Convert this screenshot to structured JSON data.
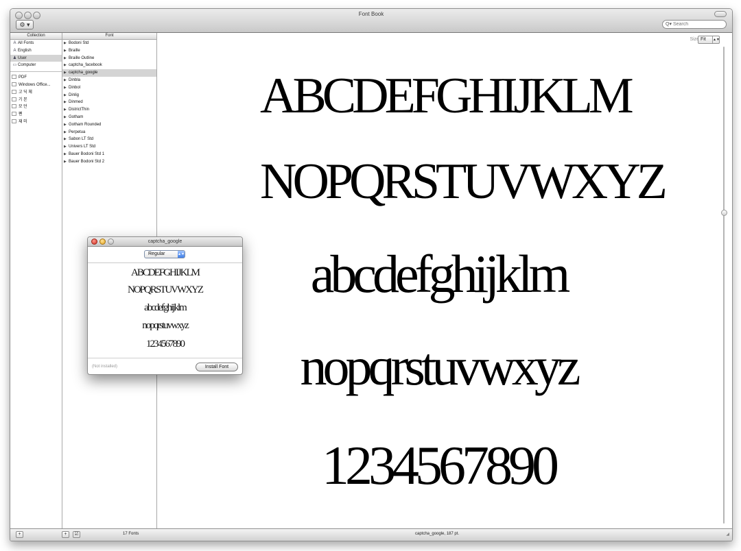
{
  "window": {
    "title": "Font Book"
  },
  "toolbar": {
    "action_label": "⚙ ▾",
    "search_placeholder": "Search"
  },
  "collections": {
    "header": "Collection",
    "items": [
      {
        "icon": "A",
        "label": "All Fonts"
      },
      {
        "icon": "A",
        "label": "English"
      },
      {
        "icon": "♟",
        "label": "User"
      },
      {
        "icon": "▭",
        "label": "Computer"
      }
    ],
    "groups": [
      "PDF",
      "Windows Office...",
      "고 딕 체",
      "기 본",
      "모 던",
      "펜",
      "재 미"
    ]
  },
  "fonts": {
    "header": "Font",
    "items": [
      "Bodoni Std",
      "Braille",
      "Braille Outline",
      "captcha_facebook",
      "captcha_google",
      "Dinbla",
      "Dinbol",
      "Dinlig",
      "Dinmed",
      "DistrictThin",
      "Gotham",
      "Gotham Rounded",
      "Perpetua",
      "Sabon LT Std",
      "Univers LT Std",
      "Bauer Bodoni Std 1",
      "Bauer Bodoni Std 2"
    ],
    "selected": "captcha_google"
  },
  "preview": {
    "size_label": "Size:",
    "size_value": "Fit",
    "lines": [
      "ABCDEFGHIJKLM",
      "NOPQRSTUVWXYZ",
      "abcdefghijklm",
      "nopqrstuvwxyz",
      "1234567890"
    ]
  },
  "bottombar": {
    "add_label": "+",
    "font_count": "17 Fonts",
    "status": "captcha_google, 187 pt."
  },
  "panel": {
    "title": "captcha_google",
    "style_value": "Regular",
    "status": "(Not installed)",
    "install_label": "Install Font"
  }
}
